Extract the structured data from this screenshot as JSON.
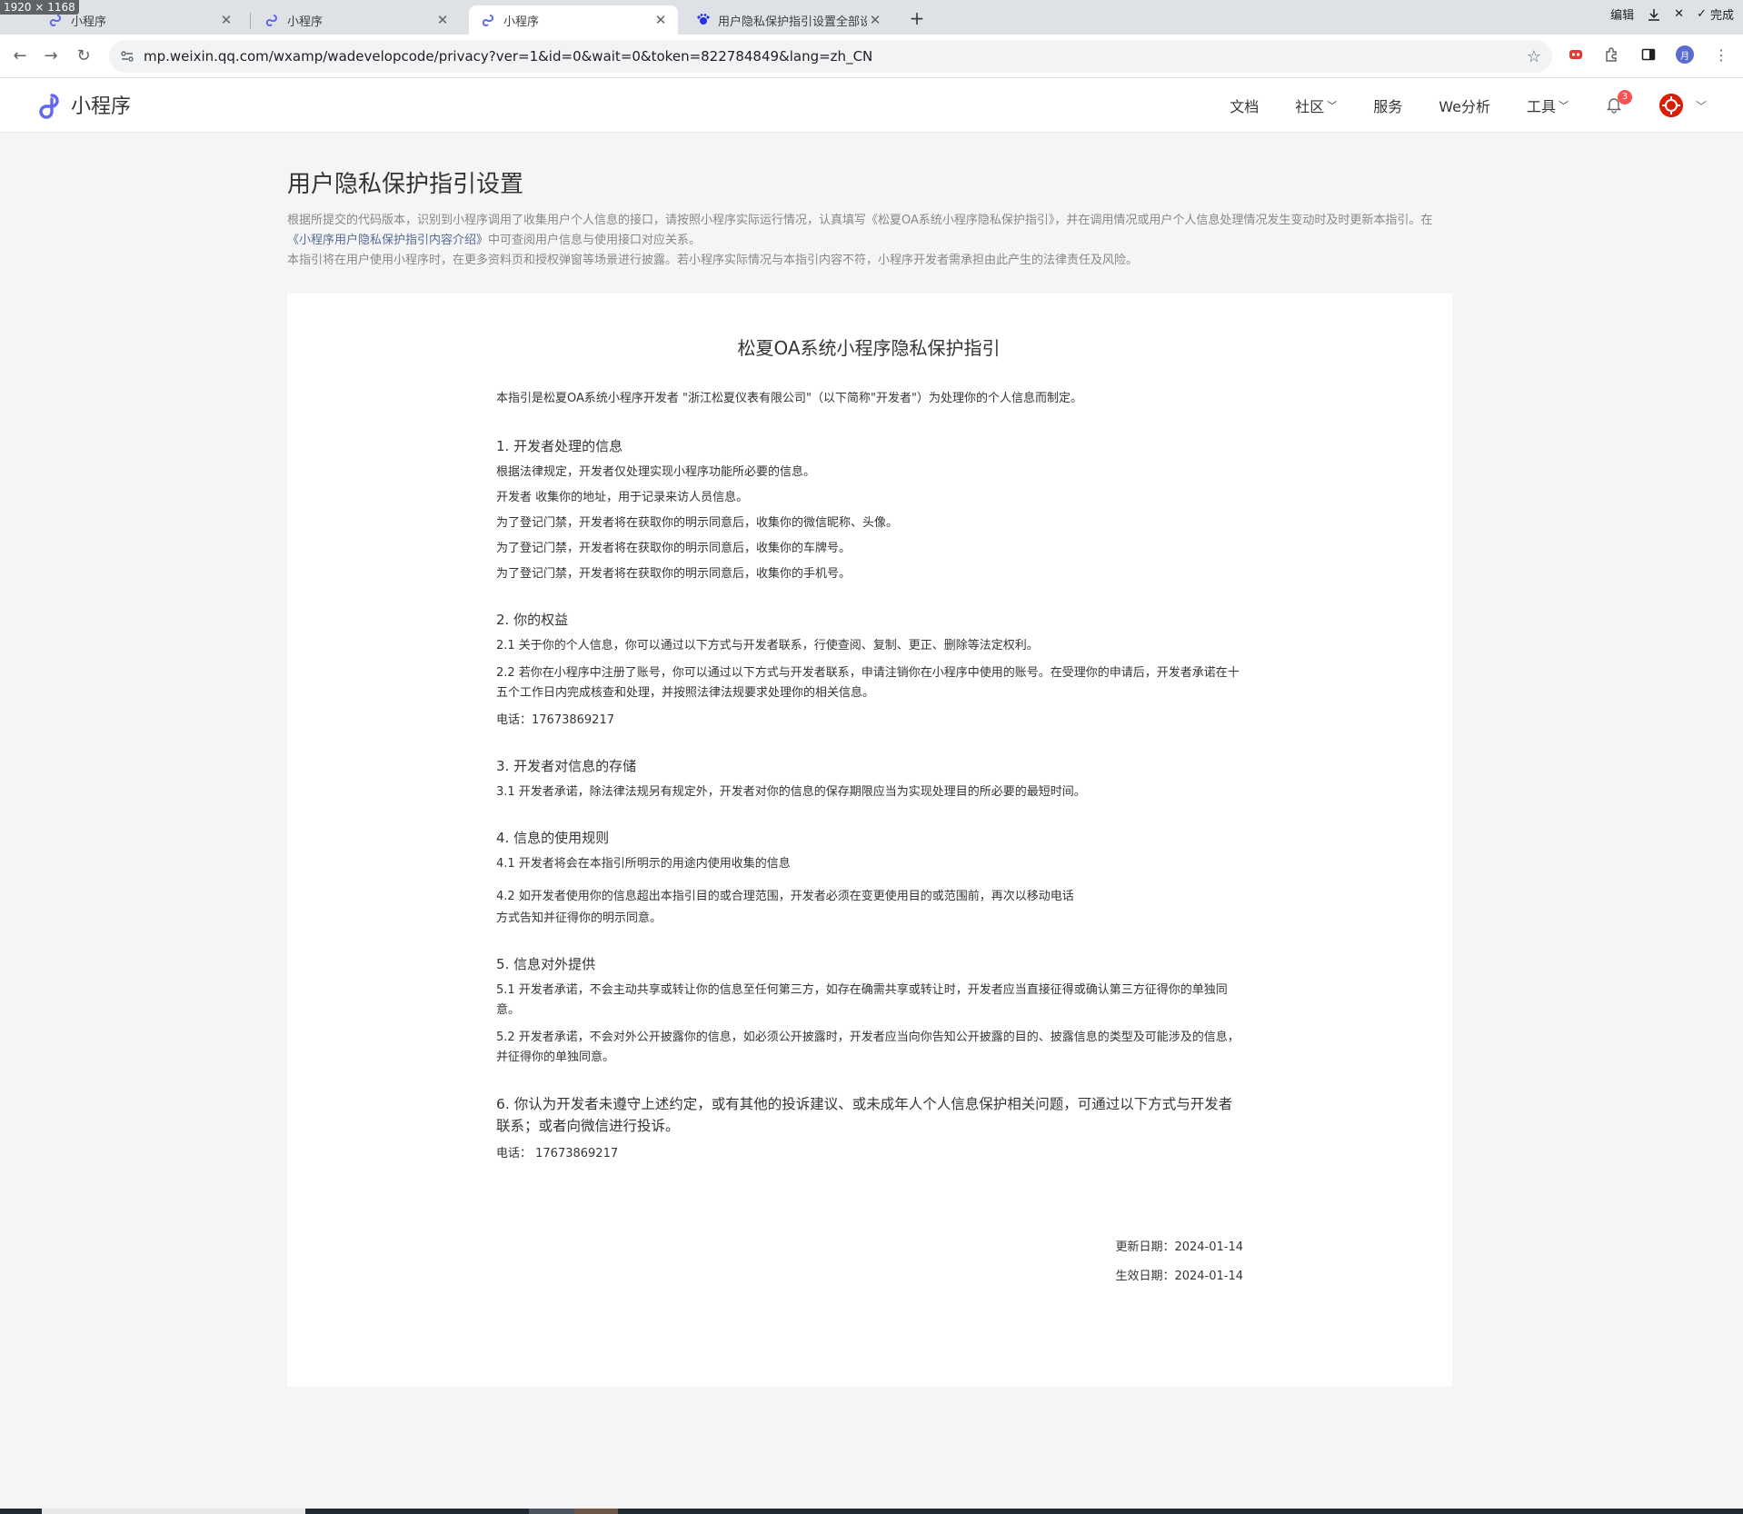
{
  "browser": {
    "dim_badge": "1920 × 1168",
    "tabs": [
      {
        "title": "小程序",
        "active": false
      },
      {
        "title": "小程序",
        "active": false
      },
      {
        "title": "小程序",
        "active": true
      },
      {
        "title": "用户隐私保护指引设置全部设置",
        "active": false
      }
    ],
    "new_tab": "+",
    "controls": {
      "edit": "编辑",
      "done": "完成"
    },
    "url": "mp.weixin.qq.com/wxamp/wadevelopcode/privacy?ver=1&id=0&wait=0&token=822784849&lang=zh_CN",
    "profile_initial": "月"
  },
  "header": {
    "brand": "小程序",
    "nav": [
      {
        "label": "文档",
        "dropdown": false
      },
      {
        "label": "社区",
        "dropdown": true
      },
      {
        "label": "服务",
        "dropdown": false
      },
      {
        "label": "We分析",
        "dropdown": false
      },
      {
        "label": "工具",
        "dropdown": true
      }
    ],
    "notification_count": "3",
    "accent": "#07c160"
  },
  "page": {
    "title": "用户隐私保护指引设置",
    "intro_1a": "根据所提交的代码版本，识别到小程序调用了收集用户个人信息的接口，请按照小程序实际运行情况，认真填写《松夏OA系统小程序隐私保护指引》，并在调用情况或用户个人信息处理情况发生变动时及时更新本指引。在",
    "intro_link": "《小程序用户隐私保护指引内容介绍》",
    "intro_1b": "中可查阅用户信息与使用接口对应关系。",
    "intro_2": "本指引将在用户使用小程序时，在更多资料页和授权弹窗等场景进行披露。若小程序实际情况与本指引内容不符，小程序开发者需承担由此产生的法律责任及风险。"
  },
  "doc": {
    "title": "松夏OA系统小程序隐私保护指引",
    "preface": "本指引是松夏OA系统小程序开发者 \"浙江松夏仪表有限公司\"（以下简称\"开发者\"）为处理你的个人信息而制定。",
    "s1": {
      "heading": "1. 开发者处理的信息",
      "lines": [
        "根据法律规定，开发者仅处理实现小程序功能所必要的信息。",
        "开发者 收集你的地址，用于记录来访人员信息。",
        "为了登记门禁，开发者将在获取你的明示同意后，收集你的微信昵称、头像。",
        "为了登记门禁，开发者将在获取你的明示同意后，收集你的车牌号。",
        "为了登记门禁，开发者将在获取你的明示同意后，收集你的手机号。"
      ]
    },
    "s2": {
      "heading": "2. 你的权益",
      "l1": "2.1  关于你的个人信息，你可以通过以下方式与开发者联系，行使查阅、复制、更正、删除等法定权利。",
      "l2": "2.2  若你在小程序中注册了账号，你可以通过以下方式与开发者联系，申请注销你在小程序中使用的账号。在受理你的申请后，开发者承诺在十五个工作日内完成核查和处理，并按照法律法规要求处理你的相关信息。",
      "phone": "电话：17673869217"
    },
    "s3": {
      "heading": "3. 开发者对信息的存储",
      "l1": "3.1   开发者承诺，除法律法规另有规定外，开发者对你的信息的保存期限应当为实现处理目的所必要的最短时间。"
    },
    "s4": {
      "heading": "4. 信息的使用规则",
      "l1": "4.1  开发者将会在本指引所明示的用途内使用收集的信息",
      "l2a": "4.2  如开发者使用你的信息超出本指引目的或合理范围，开发者必须在变更使用目的或范围前，再次以移动电话",
      "l2b": "方式告知并征得你的明示同意。"
    },
    "s5": {
      "heading": "5. 信息对外提供",
      "l1": "5.1  开发者承诺，不会主动共享或转让你的信息至任何第三方，如存在确需共享或转让时，开发者应当直接征得或确认第三方征得你的单独同意。",
      "l2": "5.2  开发者承诺，不会对外公开披露你的信息，如必须公开披露时，开发者应当向你告知公开披露的目的、披露信息的类型及可能涉及的信息，并征得你的单独同意。"
    },
    "s6": {
      "heading": "6. 你认为开发者未遵守上述约定，或有其他的投诉建议、或未成年人个人信息保护相关问题，可通过以下方式与开发者联系；或者向微信进行投诉。",
      "phone": "电话：  17673869217"
    },
    "updated": "更新日期：2024-01-14",
    "effective": "生效日期：2024-01-14"
  }
}
